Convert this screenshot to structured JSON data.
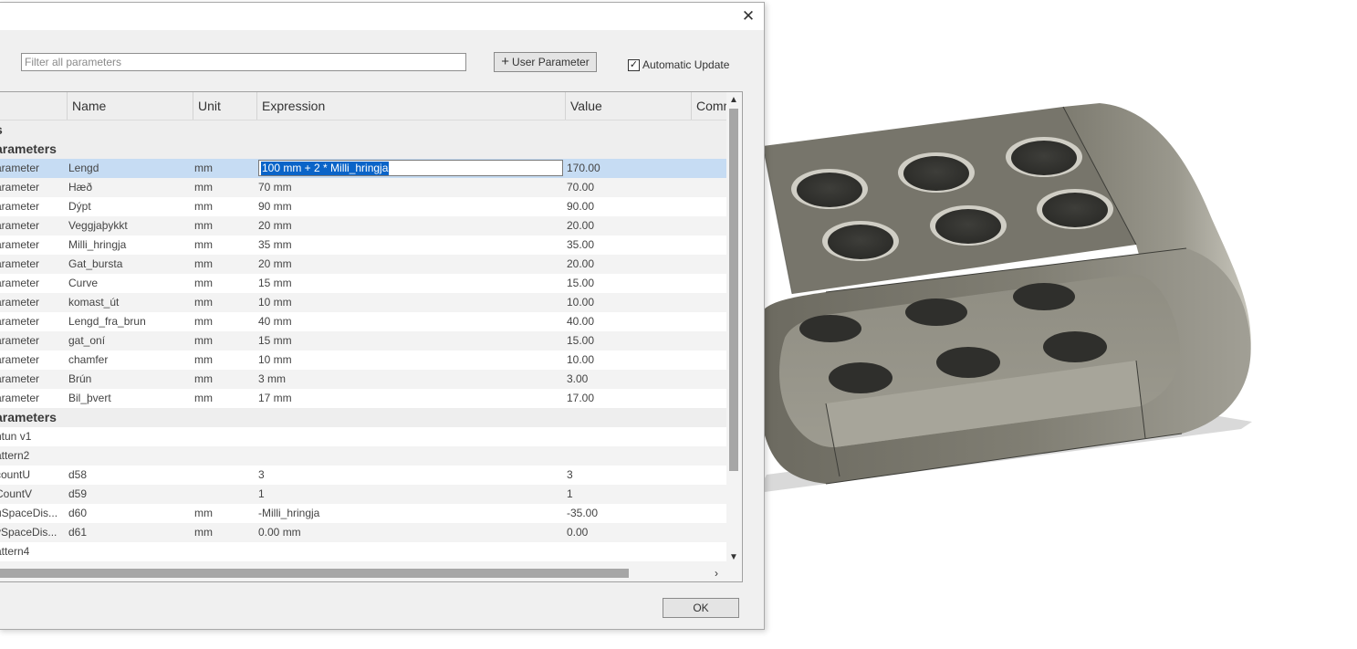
{
  "dialog": {
    "close_symbol": "✕",
    "filter_placeholder": "Filter all parameters",
    "user_parameter_label": "User Parameter",
    "user_parameter_icon": "+",
    "auto_update_label": "Automatic Update",
    "auto_update_checked": true,
    "ok_label": "OK"
  },
  "table": {
    "columns": [
      "",
      "Name",
      "Unit",
      "Expression",
      "Value",
      "Comm"
    ],
    "rows": [
      {
        "kind": "group",
        "label": "s"
      },
      {
        "kind": "group",
        "label": "arameters"
      },
      {
        "kind": "param",
        "c0": "arameter",
        "name": "Lengd",
        "unit": "mm",
        "expr": "100 mm + 2 * Milli_hringja",
        "value": "170.00",
        "selected": true
      },
      {
        "kind": "param",
        "c0": "arameter",
        "name": "Hæð",
        "unit": "mm",
        "expr": "70 mm",
        "value": "70.00"
      },
      {
        "kind": "param",
        "c0": "arameter",
        "name": "Dýpt",
        "unit": "mm",
        "expr": "90 mm",
        "value": "90.00"
      },
      {
        "kind": "param",
        "c0": "arameter",
        "name": "Veggjaþykkt",
        "unit": "mm",
        "expr": "20 mm",
        "value": "20.00"
      },
      {
        "kind": "param",
        "c0": "arameter",
        "name": "Milli_hringja",
        "unit": "mm",
        "expr": "35 mm",
        "value": "35.00"
      },
      {
        "kind": "param",
        "c0": "arameter",
        "name": "Gat_bursta",
        "unit": "mm",
        "expr": "20 mm",
        "value": "20.00"
      },
      {
        "kind": "param",
        "c0": "arameter",
        "name": "Curve",
        "unit": "mm",
        "expr": "15 mm",
        "value": "15.00"
      },
      {
        "kind": "param",
        "c0": "arameter",
        "name": "komast_út",
        "unit": "mm",
        "expr": "10 mm",
        "value": "10.00"
      },
      {
        "kind": "param",
        "c0": "arameter",
        "name": "Lengd_fra_brun",
        "unit": "mm",
        "expr": "40 mm",
        "value": "40.00"
      },
      {
        "kind": "param",
        "c0": "arameter",
        "name": "gat_oní",
        "unit": "mm",
        "expr": "15 mm",
        "value": "15.00"
      },
      {
        "kind": "param",
        "c0": "arameter",
        "name": "chamfer",
        "unit": "mm",
        "expr": "10 mm",
        "value": "10.00"
      },
      {
        "kind": "param",
        "c0": "arameter",
        "name": "Brún",
        "unit": "mm",
        "expr": "3 mm",
        "value": "3.00"
      },
      {
        "kind": "param",
        "c0": "arameter",
        "name": "Bil_þvert",
        "unit": "mm",
        "expr": "17 mm",
        "value": "17.00"
      },
      {
        "kind": "group",
        "label": "arameters"
      },
      {
        "kind": "item",
        "c0": "ntun v1",
        "name": "",
        "unit": "",
        "expr": "",
        "value": ""
      },
      {
        "kind": "item",
        "c0": "attern2",
        "name": "",
        "unit": "",
        "expr": "",
        "value": ""
      },
      {
        "kind": "param",
        "c0": "countU",
        "name": "d58",
        "unit": "",
        "expr": "3",
        "value": "3"
      },
      {
        "kind": "param",
        "c0": "CountV",
        "name": "d59",
        "unit": "",
        "expr": "1",
        "value": "1"
      },
      {
        "kind": "param",
        "c0": "uSpaceDis...",
        "name": "d60",
        "unit": "mm",
        "expr": "-Milli_hringja",
        "value": "-35.00"
      },
      {
        "kind": "param",
        "c0": "vSpaceDis...",
        "name": "d61",
        "unit": "mm",
        "expr": "0.00 mm",
        "value": "0.00"
      },
      {
        "kind": "item",
        "c0": "attern4",
        "name": "",
        "unit": "",
        "expr": "",
        "value": ""
      }
    ]
  },
  "colors": {
    "selected_row": "#c6dcf3",
    "selection_highlight": "#0a64c8"
  }
}
